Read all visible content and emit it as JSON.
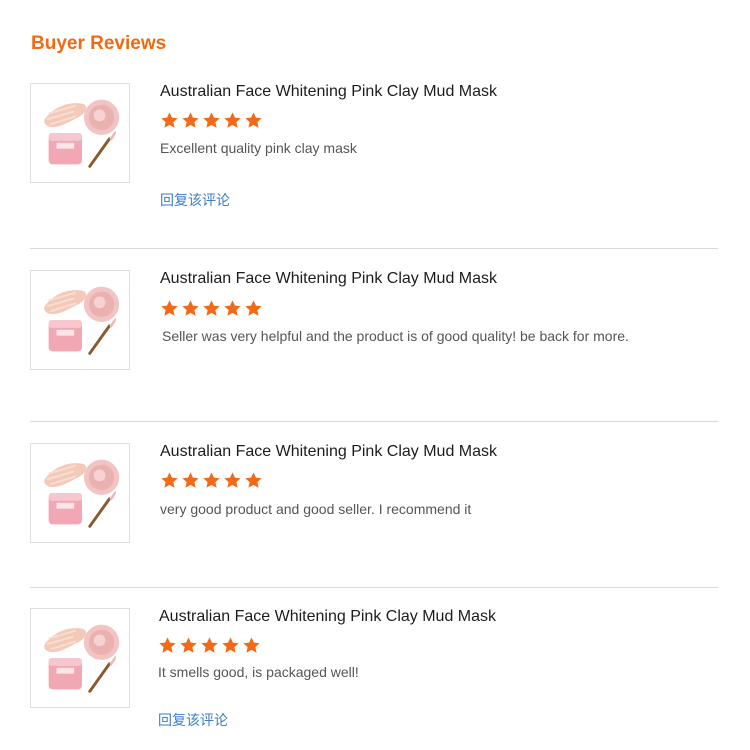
{
  "section": {
    "title": "Buyer Reviews"
  },
  "colors": {
    "accent": "#f06a13",
    "star": "#f26a18",
    "link": "#3a7ec6",
    "divider": "#d9d9d9"
  },
  "reviews": [
    {
      "product_title": "Australian Face Whitening Pink Clay Mud Mask",
      "rating": 5,
      "comment": "Excellent quality pink clay mask",
      "reply_label": "回复该评论",
      "image_icon": "pink-clay-mask-jar-and-brush"
    },
    {
      "product_title": "Australian Face Whitening Pink Clay Mud Mask",
      "rating": 5,
      "comment": "Seller was very helpful and the product is of good quality!  be back for more.",
      "image_icon": "pink-clay-mask-jar-and-brush"
    },
    {
      "product_title": "Australian Face Whitening Pink Clay Mud Mask",
      "rating": 5,
      "comment": "very good product and good seller. I recommend it",
      "image_icon": "pink-clay-mask-jar-and-brush"
    },
    {
      "product_title": "Australian Face Whitening Pink Clay Mud Mask",
      "rating": 5,
      "comment": "It smells good, is packaged well!",
      "reply_label": "回复该评论",
      "image_icon": "pink-clay-mask-jar-and-brush"
    }
  ]
}
